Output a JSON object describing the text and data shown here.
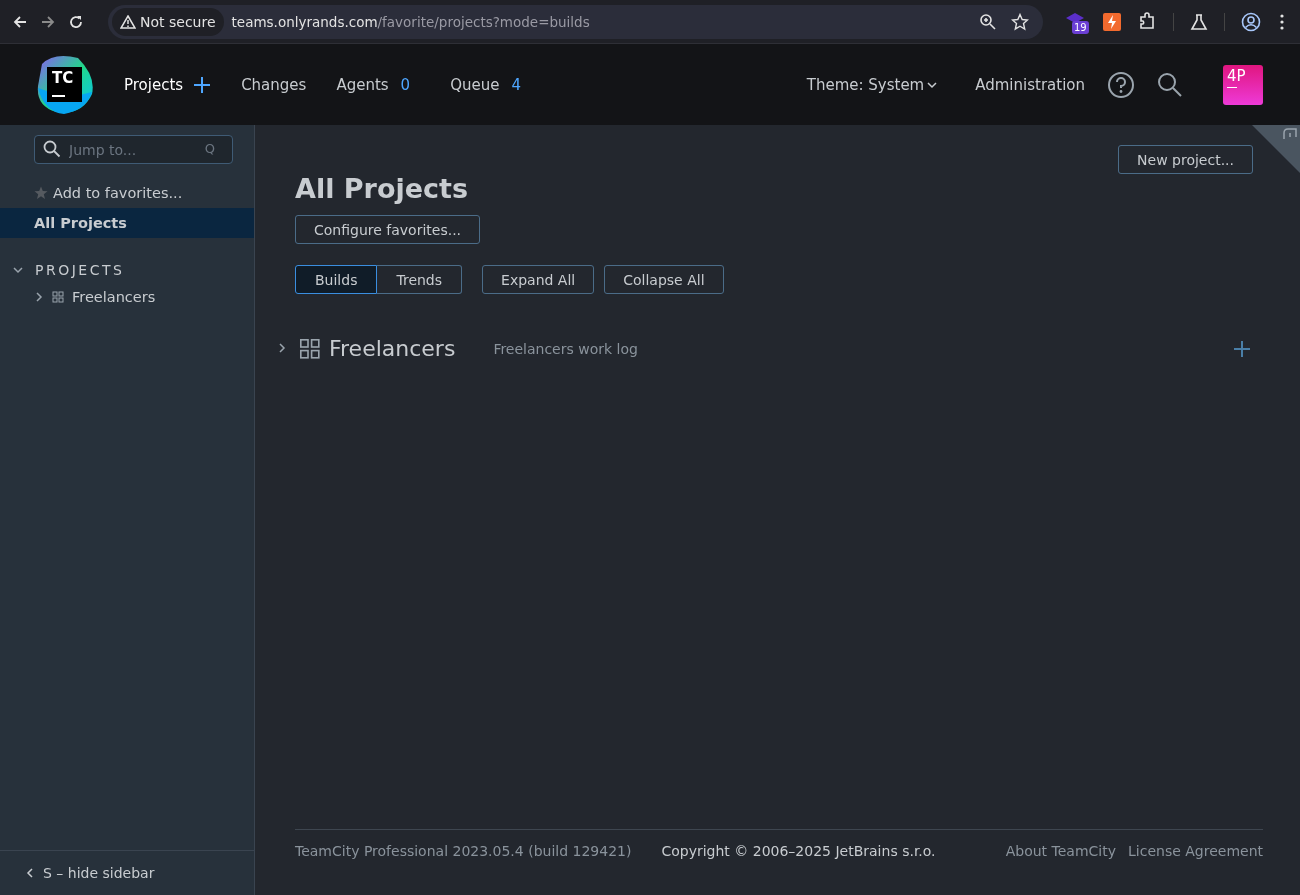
{
  "browser": {
    "security": "Not secure",
    "url_host": "teams.onlyrands.com",
    "url_path": "/favorite/projects?mode=builds",
    "extension_badge": "19"
  },
  "header": {
    "logo": "TC",
    "nav": [
      {
        "label": "Projects",
        "kind": "add"
      },
      {
        "label": "Changes",
        "kind": "plain"
      },
      {
        "label": "Agents",
        "kind": "count",
        "count": "0"
      },
      {
        "label": "Queue",
        "kind": "count",
        "count": "4"
      }
    ],
    "theme": "Theme: System",
    "admin": "Administration",
    "avatar": "4P"
  },
  "sidebar": {
    "search": {
      "placeholder": "Jump to...",
      "shortcut": "Q"
    },
    "add_favorites": "Add to favorites...",
    "items": [
      {
        "label": "All Projects",
        "selected": true
      }
    ],
    "section": {
      "title": "PROJECTS",
      "expanded": true,
      "children": [
        {
          "label": "Freelancers",
          "expanded": false
        }
      ]
    },
    "hide": "S – hide sidebar"
  },
  "main": {
    "title": "All Projects",
    "new_project": "New project...",
    "configure": "Configure favorites...",
    "modes": [
      {
        "label": "Builds",
        "selected": true
      },
      {
        "label": "Trends",
        "selected": false
      }
    ],
    "actions": [
      "Expand All",
      "Collapse All"
    ],
    "projects": [
      {
        "name": "Freelancers",
        "description": "Freelancers work log",
        "expanded": false
      }
    ]
  },
  "footer": {
    "version": "TeamCity Professional 2023.05.4 (build 129421)",
    "copyright": "Copyright © 2006–2025 JetBrains s.r.o.",
    "links": [
      "About TeamCity",
      "License Agreement"
    ]
  }
}
